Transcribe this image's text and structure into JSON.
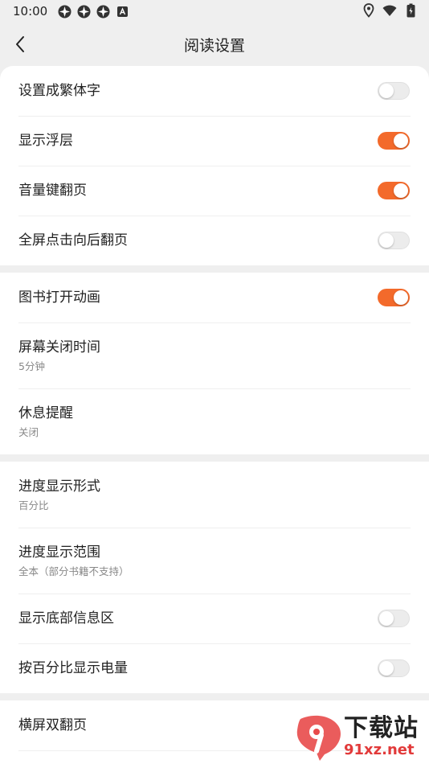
{
  "status_bar": {
    "time": "10:00",
    "left_icons": [
      "notification-icon",
      "notification-icon",
      "notification-icon",
      "text-badge-icon"
    ],
    "right_icons": [
      "location-icon",
      "wifi-icon",
      "battery-icon"
    ]
  },
  "header": {
    "title": "阅读设置",
    "back_icon": "chevron-left-icon"
  },
  "colors": {
    "accent": "#f36a2b",
    "background": "#efefef",
    "card": "#ffffff"
  },
  "groups": [
    {
      "rows": [
        {
          "label": "设置成繁体字",
          "toggle": false
        },
        {
          "label": "显示浮层",
          "toggle": true
        },
        {
          "label": "音量键翻页",
          "toggle": true
        },
        {
          "label": "全屏点击向后翻页",
          "toggle": false
        }
      ]
    },
    {
      "rows": [
        {
          "label": "图书打开动画",
          "toggle": true
        },
        {
          "label": "屏幕关闭时间",
          "sub": "5分钟"
        },
        {
          "label": "休息提醒",
          "sub": "关闭"
        }
      ]
    },
    {
      "rows": [
        {
          "label": "进度显示形式",
          "sub": "百分比"
        },
        {
          "label": "进度显示范围",
          "sub": "全本（部分书籍不支持）"
        },
        {
          "label": "显示底部信息区",
          "toggle": false
        },
        {
          "label": "按百分比显示电量",
          "toggle": false
        }
      ]
    },
    {
      "rows": [
        {
          "label": "横屏双翻页"
        }
      ]
    }
  ],
  "watermark": {
    "logo_text": "9",
    "top_text": "下载站",
    "bottom_text": "91xz.net"
  }
}
